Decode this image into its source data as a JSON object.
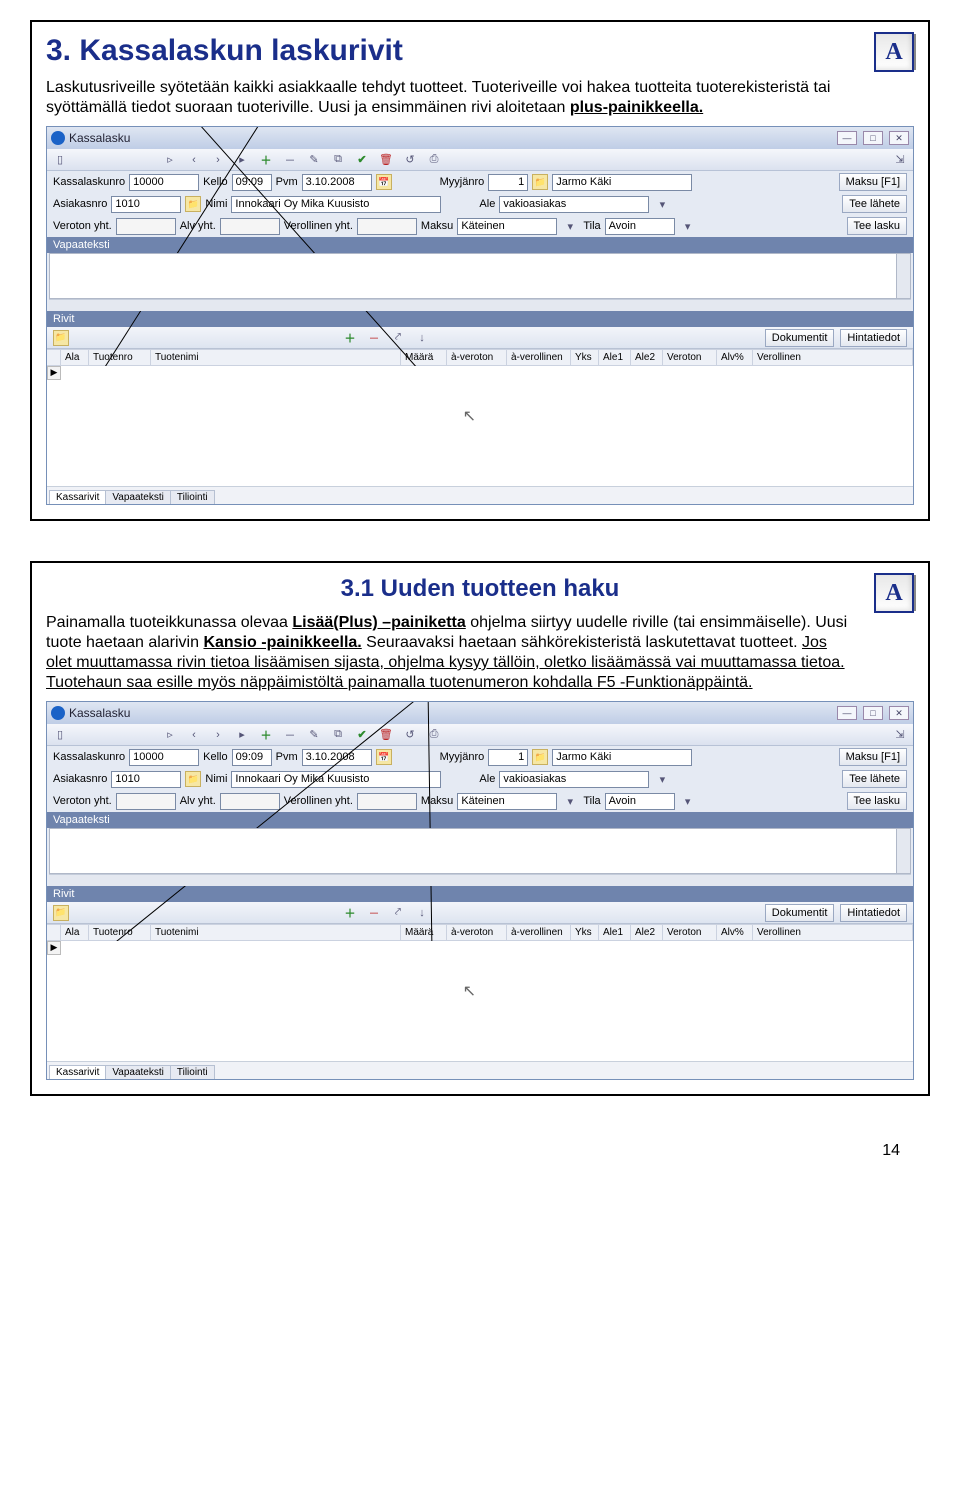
{
  "page_number": "14",
  "slide1": {
    "title": "3. Kassalaskun laskurivit",
    "intro_a": "Laskutusriveille syötetään kaikki asiakkaalle tehdyt tuotteet. Tuoteriveille voi hakea tuotteita tuoterekisteristä tai syöttämällä tiedot suoraan tuoteriville. Uusi ja ensimmäinen rivi aloitetaan ",
    "intro_b": "plus-painikkeella."
  },
  "slide2": {
    "title": "3.1 Uuden tuotteen haku",
    "p1a": "Painamalla tuoteikkunassa olevaa ",
    "p1b": "Lisää(Plus) –painiketta",
    "p1c": " ohjelma siirtyy uudelle riville (tai ensimmäiselle). Uusi tuote haetaan alarivin ",
    "p1d": "Kansio -painikkeella.",
    "p1e": " Seuraavaksi haetaan sähkörekisteristä laskutettavat tuotteet. ",
    "p1f": "Jos olet muuttamassa rivin tietoa lisäämisen sijasta, ohjelma kysyy tällöin, oletko lisäämässä vai muuttamassa tietoa.",
    "p1g": " Tuotehaun saa esille myös näppäimistöltä painamalla tuotenumeron kohdalla F5 -Funktionäppäintä."
  },
  "app": {
    "title": "Kassalasku",
    "labels": {
      "kassalaskunro": "Kassalaskunro",
      "kello": "Kello",
      "pvm": "Pvm",
      "myyjanro": "Myyjänro",
      "maksu_f1": "Maksu [F1]",
      "asiakasnro": "Asiakasnro",
      "nimi": "Nimi",
      "ale": "Ale",
      "tee_lahete": "Tee lähete",
      "veroton_yht": "Veroton yht.",
      "alv_yht": "Alv yht.",
      "verollinen_yht": "Verollinen yht.",
      "maksu": "Maksu",
      "tila": "Tila",
      "tee_lasku": "Tee lasku",
      "vapaateksti": "Vapaateksti",
      "rivit": "Rivit",
      "dokumentit": "Dokumentit",
      "hintatiedot": "Hintatiedot"
    },
    "values": {
      "kassalaskunro": "10000",
      "kello": "09:09",
      "pvm": "3.10.2008",
      "myyjanro": "1",
      "myyja": "Jarmo Käki",
      "asiakasnro": "1010",
      "asiakasnimi": "Innokaari Oy Mika Kuusisto",
      "ale": "vakioasiakas",
      "maksu": "Käteinen",
      "tila": "Avoin"
    },
    "cols": [
      "Ala",
      "Tuotenro",
      "Tuotenimi",
      "Määrä",
      "à-veroton",
      "à-verollinen",
      "Yks",
      "Ale1",
      "Ale2",
      "Veroton",
      "Alv%",
      "Verollinen"
    ],
    "tabs": [
      "Kassarivit",
      "Vapaateksti",
      "Tiliointi"
    ]
  }
}
